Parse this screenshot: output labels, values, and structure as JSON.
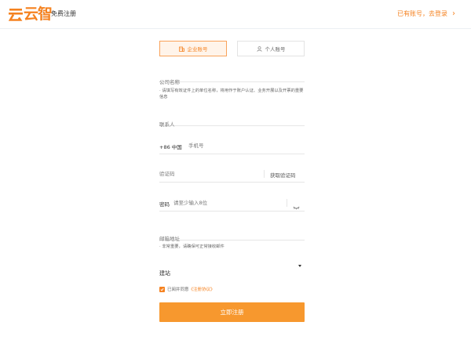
{
  "header": {
    "logo_text": "云智",
    "page_title": "免费注册",
    "login_link": "已有账号，去登录",
    "brand_color": "#f58220"
  },
  "tabs": [
    {
      "label": "企业账号",
      "icon": "company-icon",
      "active": true
    },
    {
      "label": "个人账号",
      "icon": "user-icon",
      "active": false
    }
  ],
  "form": {
    "company": {
      "label": "公司名称",
      "hint": "· 请填写有效证件上的单位名称，将用作于账户认证、业务开展以及开票的重要信息"
    },
    "contact": {
      "placeholder": "联系人"
    },
    "phone": {
      "country_code": "+86 中国",
      "placeholder": "手机号"
    },
    "code": {
      "placeholder": "验证码",
      "button": "获取验证码"
    },
    "password": {
      "label": "密码",
      "placeholder": "请至少输入8位"
    },
    "email": {
      "placeholder": "邮箱地址",
      "hint": "· 非常重要，请确保可正常接收邮件"
    },
    "site": {
      "value": "建站"
    },
    "agreement": {
      "prefix": "已阅并同意",
      "link": "《注册协议》",
      "checked": true
    },
    "submit": "立即注册"
  }
}
